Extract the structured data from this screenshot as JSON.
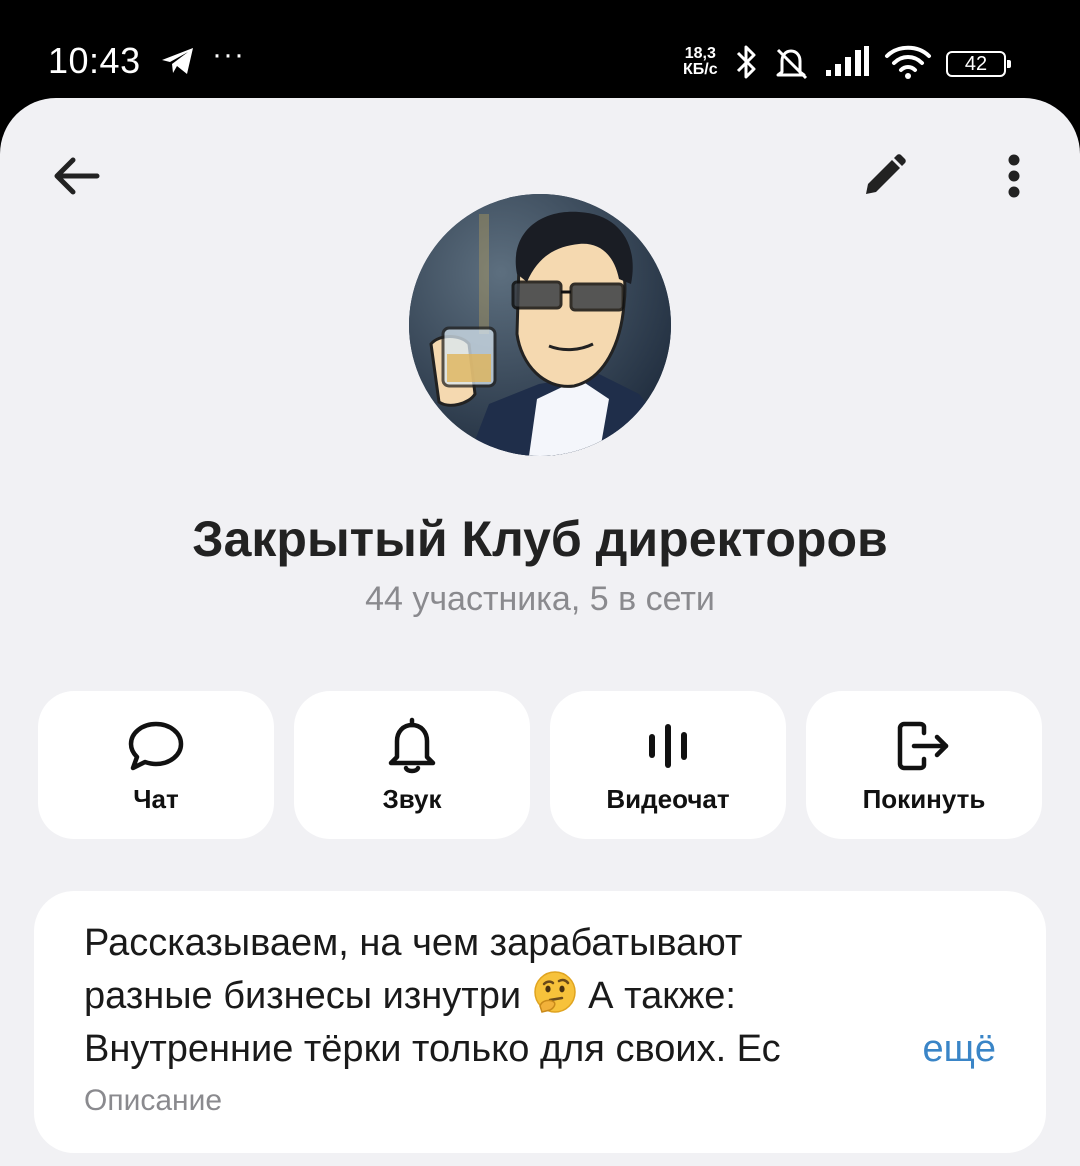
{
  "status_bar": {
    "time": "10:43",
    "dots": "···",
    "speed_value": "18,3",
    "speed_unit": "КБ/с",
    "battery": "42",
    "icons": [
      "telegram-icon",
      "bluetooth-icon",
      "bell-off-icon",
      "signal-icon",
      "wifi-icon",
      "battery-icon"
    ]
  },
  "header": {
    "back_icon": "arrow-left-icon",
    "edit_icon": "pencil-icon",
    "more_icon": "more-vertical-icon"
  },
  "group": {
    "title": "Закрытый Клуб директоров",
    "subtitle": "44 участника, 5 в сети"
  },
  "actions": [
    {
      "label": "Чат",
      "icon": "chat-bubble-icon"
    },
    {
      "label": "Звук",
      "icon": "bell-icon"
    },
    {
      "label": "Видеочат",
      "icon": "voice-wave-icon"
    },
    {
      "label": "Покинуть",
      "icon": "leave-icon"
    }
  ],
  "description": {
    "line1": "Рассказываем, на чем зарабатывают",
    "line2a": "разные бизнесы изнутри",
    "line2b": " А также:",
    "line3": "Внутренние тёрки только для своих. Ес",
    "more": "ещё",
    "label": "Описание"
  },
  "colors": {
    "background": "#f1f1f4",
    "card": "#ffffff",
    "link": "#3a85c7",
    "subtitle": "#8a8a8e"
  }
}
